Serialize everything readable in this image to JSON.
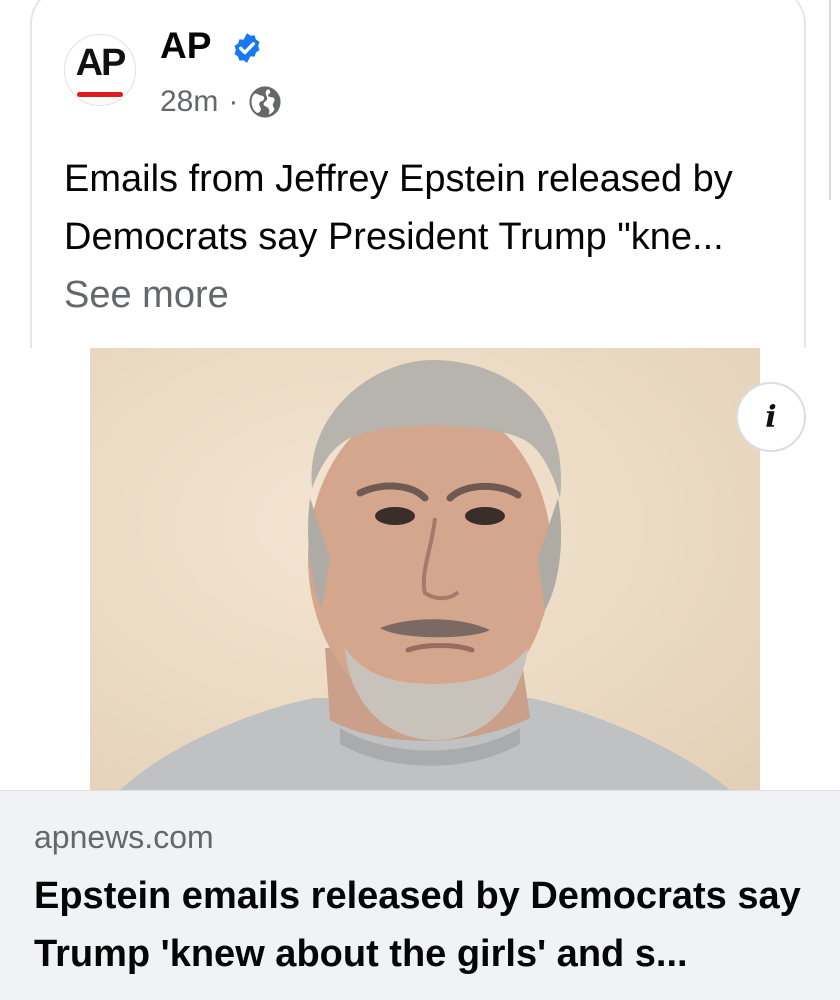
{
  "post": {
    "avatar_text": "AP",
    "page_name": "AP",
    "timestamp": "28m",
    "separator": "·",
    "audience_icon": "globe-icon",
    "verified_icon": "verified-badge-icon",
    "text": "Emails from Jeffrey Epstein released by Democrats say President Trump \"kne...",
    "see_more_label": "See more"
  },
  "photo": {
    "info_icon": "info-icon",
    "info_glyph": "i"
  },
  "link": {
    "domain": "apnews.com",
    "title": "Epstein emails released by Democrats say Trump 'knew about the girls' and s..."
  },
  "colors": {
    "verified_blue": "#1877f2",
    "secondary_text": "#65676b",
    "ap_red": "#e01b1b",
    "link_bg": "#f0f2f5"
  }
}
